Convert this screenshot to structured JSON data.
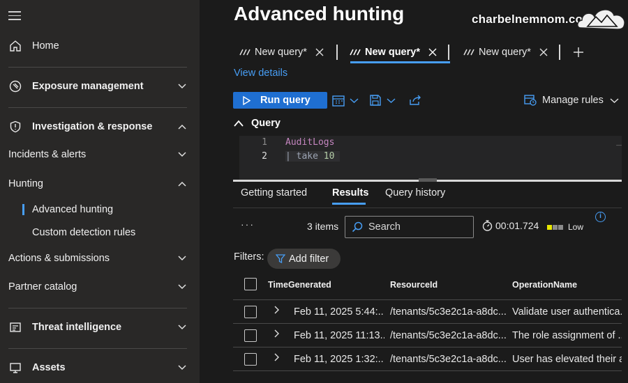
{
  "sidebar": {
    "home": "Home",
    "exposure": "Exposure management",
    "investigation": "Investigation & response",
    "incidents": "Incidents & alerts",
    "hunting": "Hunting",
    "advanced_hunting": "Advanced hunting",
    "custom_detection": "Custom detection rules",
    "actions": "Actions & submissions",
    "partner": "Partner catalog",
    "threat_intel": "Threat intelligence",
    "assets": "Assets"
  },
  "page_title": "Advanced hunting",
  "watermark": "charbelnemnom.com",
  "query_tabs": [
    "New query*",
    "New query*",
    "New query*"
  ],
  "view_details": "View details",
  "toolbar": {
    "run_query": "Run query",
    "manage_rules": "Manage rules"
  },
  "query_section": "Query",
  "editor": {
    "lines": [
      "1",
      "2"
    ],
    "line1": "AuditLogs",
    "line2_pipe": "| ",
    "line2_kw": "take ",
    "line2_num": "10"
  },
  "result_tabs": [
    "Getting started",
    "Results",
    "Query history"
  ],
  "results_bar": {
    "more": "···",
    "items": "3 items",
    "search_placeholder": "Search",
    "elapsed": "00:01.724",
    "level": "Low"
  },
  "filters": {
    "label": "Filters:",
    "add_filter": "Add filter"
  },
  "table": {
    "columns": [
      "TimeGenerated",
      "ResourceId",
      "OperationName"
    ],
    "rows": [
      [
        "Feb 11, 2025 5:44:...",
        "/tenants/5c3e2c1a-a8dc...",
        "Validate user authentica..."
      ],
      [
        "Feb 11, 2025 11:13...",
        "/tenants/5c3e2c1a-a8dc...",
        "The role assignment of ..."
      ],
      [
        "Feb 11, 2025 1:32:...",
        "/tenants/5c3e2c1a-a8dc...",
        "User has elevated their a..."
      ]
    ]
  },
  "colors": {
    "accent": "#479ef5",
    "primary_button": "#1f6fd1",
    "sidebar_bg": "#292827",
    "main_bg": "#1b1b1b",
    "level_low": "#e8e800"
  },
  "icons": [
    "hamburger-icon",
    "home-icon",
    "compass-icon",
    "shield-icon",
    "chevron-down-icon",
    "chevron-up-icon",
    "report-icon",
    "assets-icon",
    "query-icon",
    "close-icon",
    "plus-icon",
    "play-icon",
    "calendar-icon",
    "save-icon",
    "share-icon",
    "manage-rules-icon",
    "search-icon",
    "stopwatch-icon",
    "filter-icon",
    "info-icon",
    "chevron-right-icon"
  ]
}
